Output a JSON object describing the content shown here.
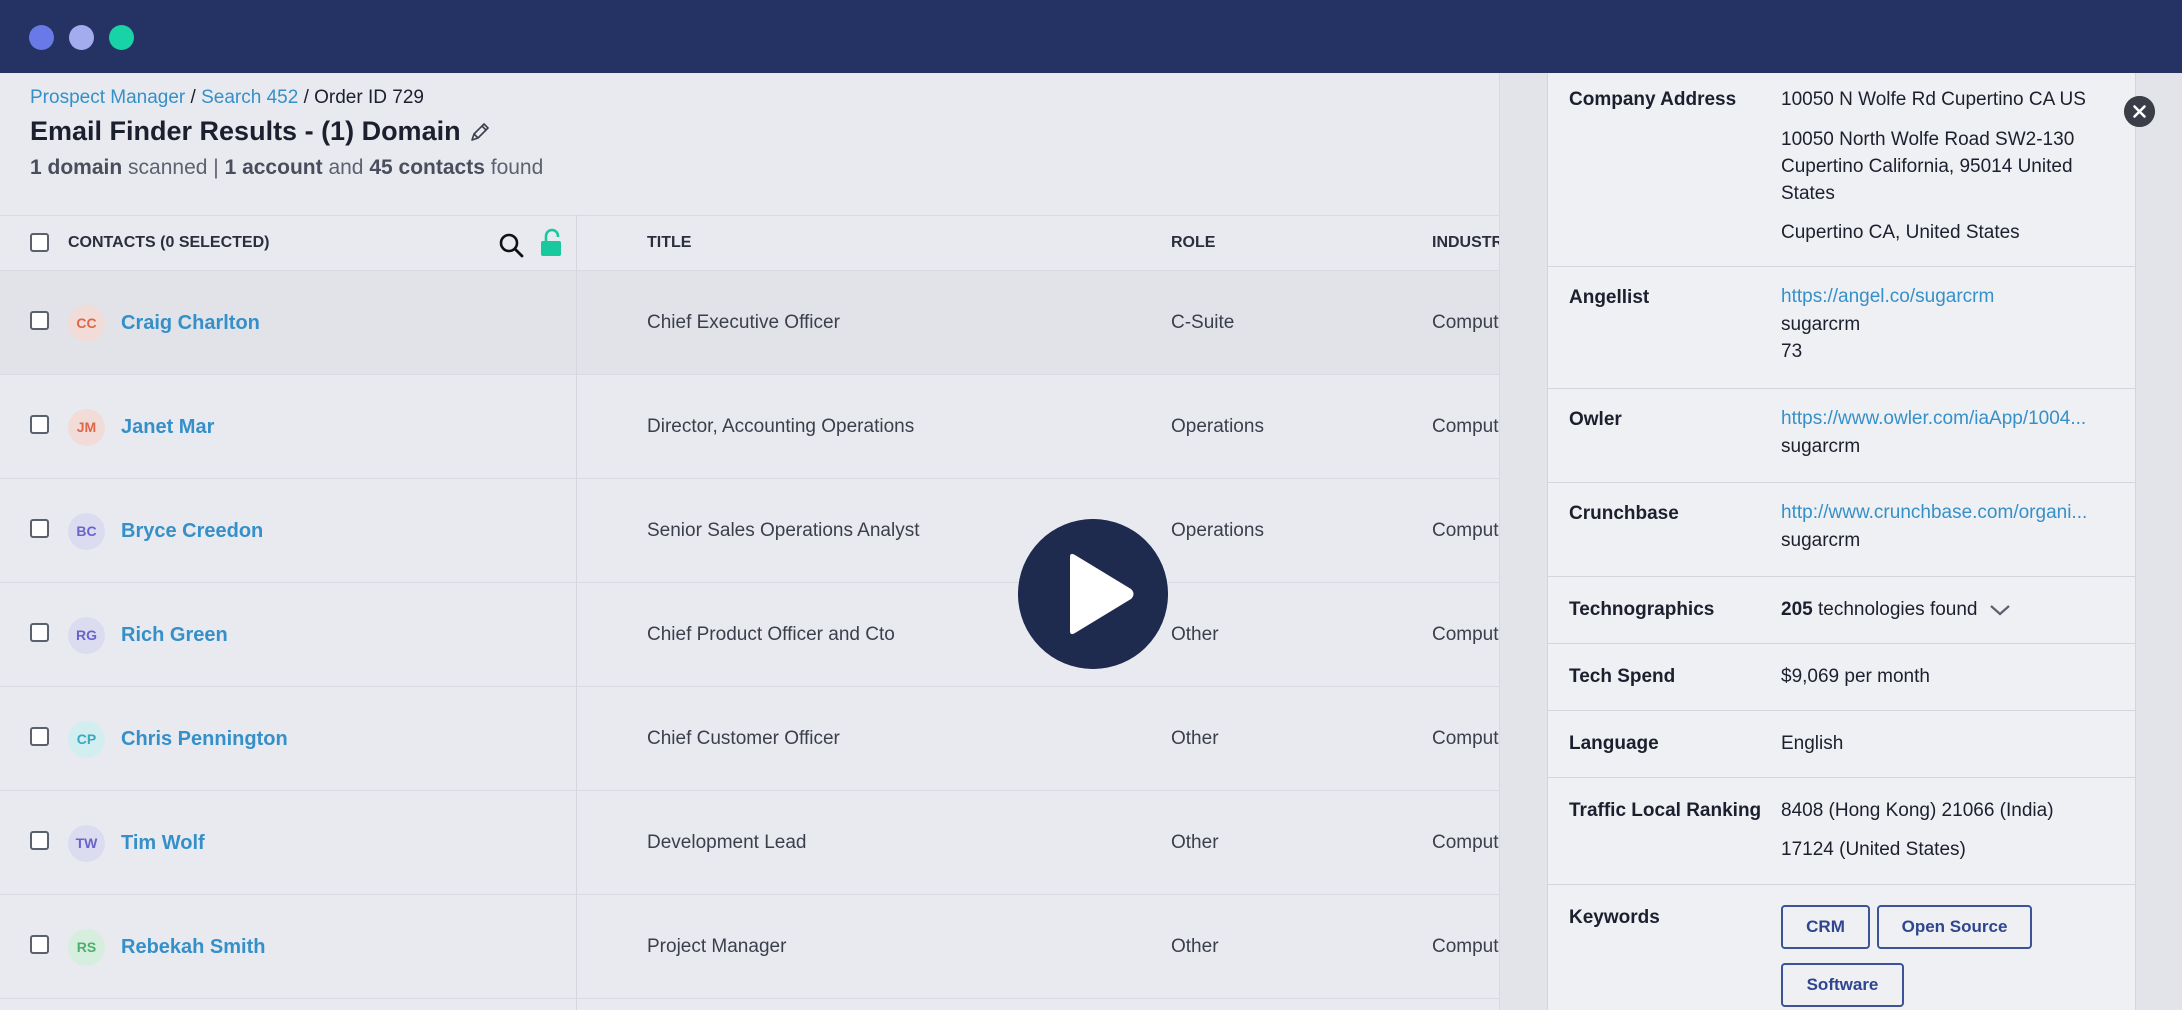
{
  "colors": {
    "topbar": "#253364",
    "link": "#3590c9",
    "accent_green": "#17d3a5",
    "chip_border": "#3c5398"
  },
  "window_controls": [
    "close-dot",
    "minimize-dot",
    "maximize-dot"
  ],
  "breadcrumb": {
    "items": [
      "Prospect Manager",
      "Search 452"
    ],
    "separator": "/",
    "current": "Order ID 729"
  },
  "page": {
    "title": "Email Finder Results - (1) Domain",
    "summary": {
      "n_domains": "1 domain",
      "scanned": "scanned |",
      "n_accounts": "1 account",
      "and": "and",
      "n_contacts": "45 contacts",
      "found": "found"
    }
  },
  "table": {
    "columns": {
      "contacts": "CONTACTS (0 SELECTED)",
      "title": "TITLE",
      "role": "ROLE",
      "industry": "INDUSTR"
    },
    "icons": [
      "search-icon",
      "unlock-icon"
    ],
    "rows": [
      {
        "initials": "CC",
        "name": "Craig Charlton",
        "title": "Chief Executive Officer",
        "role": "C-Suite",
        "industry": "Comput",
        "avatar_bg": "#f2dcd7",
        "avatar_fg": "#e0664a"
      },
      {
        "initials": "JM",
        "name": "Janet Mar",
        "title": "Director, Accounting Operations",
        "role": "Operations",
        "industry": "Comput",
        "avatar_bg": "#f2dcd7",
        "avatar_fg": "#e0664a"
      },
      {
        "initials": "BC",
        "name": "Bryce Creedon",
        "title": "Senior Sales Operations Analyst",
        "role": "Operations",
        "industry": "Comput",
        "avatar_bg": "#dcdcf0",
        "avatar_fg": "#6a63c9"
      },
      {
        "initials": "RG",
        "name": "Rich Green",
        "title": "Chief Product Officer and Cto",
        "role": "Other",
        "industry": "Comput",
        "avatar_bg": "#dcdcf0",
        "avatar_fg": "#6a63c9"
      },
      {
        "initials": "CP",
        "name": "Chris Pennington",
        "title": "Chief Customer Officer",
        "role": "Other",
        "industry": "Comput",
        "avatar_bg": "#d3eef1",
        "avatar_fg": "#37a9bf"
      },
      {
        "initials": "TW",
        "name": "Tim Wolf",
        "title": "Development Lead",
        "role": "Other",
        "industry": "Comput",
        "avatar_bg": "#dcdcf0",
        "avatar_fg": "#6a63c9"
      },
      {
        "initials": "RS",
        "name": "Rebekah Smith",
        "title": "Project Manager",
        "role": "Other",
        "industry": "Comput",
        "avatar_bg": "#d5eedd",
        "avatar_fg": "#4cb06d"
      }
    ]
  },
  "video_overlay": {
    "icon": "play-icon"
  },
  "panel": {
    "close_icon": "close-icon",
    "company_address": {
      "label": "Company Address",
      "lines": [
        "10050 N Wolfe Rd Cupertino CA US",
        "10050 North Wolfe Road SW2-130 Cupertino California, 95014 United States",
        "Cupertino CA, United States"
      ]
    },
    "angellist": {
      "label": "Angellist",
      "url": "https://angel.co/sugarcrm",
      "handle": "sugarcrm",
      "count": "73"
    },
    "owler": {
      "label": "Owler",
      "url": "https://www.owler.com/iaApp/1004...",
      "handle": "sugarcrm"
    },
    "crunchbase": {
      "label": "Crunchbase",
      "url": "http://www.crunchbase.com/organi...",
      "handle": "sugarcrm"
    },
    "technographics": {
      "label": "Technographics",
      "count": "205",
      "text": "technologies found",
      "icon": "chevron-down-icon"
    },
    "tech_spend": {
      "label": "Tech Spend",
      "value": "$9,069 per month"
    },
    "language": {
      "label": "Language",
      "value": "English"
    },
    "traffic": {
      "label": "Traffic Local Ranking",
      "lines": [
        "8408 (Hong Kong) 21066 (India)",
        "17124 (United States)"
      ]
    },
    "keywords": {
      "label": "Keywords",
      "chips": [
        "CRM",
        "Open Source",
        "Software"
      ]
    }
  }
}
